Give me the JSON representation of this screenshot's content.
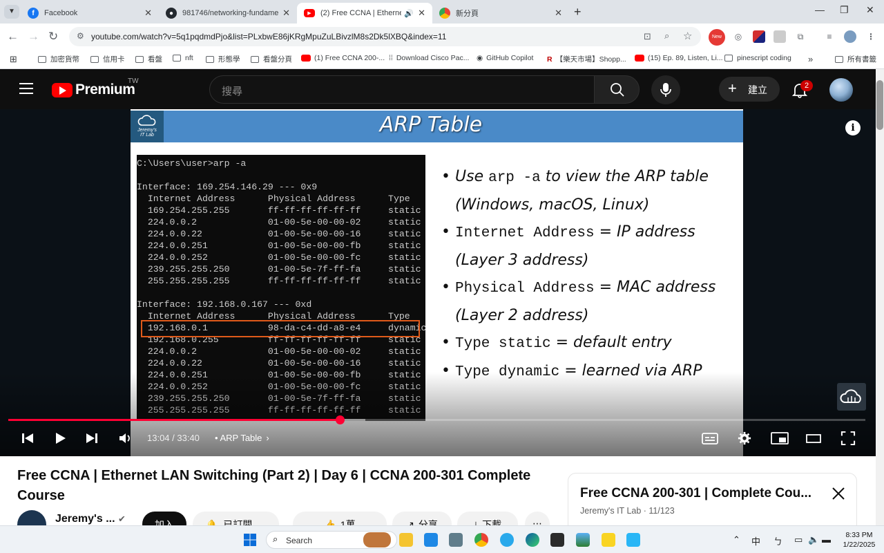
{
  "browser": {
    "tabs": [
      {
        "title": "Facebook",
        "favicon": "facebook-icon",
        "active": false
      },
      {
        "title": "981746/networking-fundament",
        "favicon": "github-icon",
        "active": false
      },
      {
        "title": "(2) Free CCNA | Ethernet LA",
        "favicon": "youtube-icon",
        "active": true
      },
      {
        "title": "新分頁",
        "favicon": "chrome-icon",
        "active": false
      }
    ],
    "new_tab": "+",
    "url": "youtube.com/watch?v=5q1pqdmdPjo&list=PLxbwE86jKRgMpuZuLBivzlM8s2Dk5lXBQ&index=11",
    "ext_new_badge": "New",
    "bookmarks": [
      "加密貨幣",
      "信用卡",
      "看盤",
      "nft",
      "形態學",
      "看盤分頁",
      "(1) Free CCNA 200-...",
      "Download Cisco Pac...",
      "GitHub Copilot",
      "【樂天市場】Shopp...",
      "(15) Ep. 89, Listen, Li...",
      "pinescript coding"
    ],
    "bookmarks_more": "»",
    "all_bookmarks": "所有書籤"
  },
  "youtube": {
    "logo_text": "Premium",
    "region": "TW",
    "search_placeholder": "搜尋",
    "create_label": "建立",
    "notification_count": "2"
  },
  "slide": {
    "logo_text_1": "Jeremy's",
    "logo_text_2": "IT Lab",
    "title": "ARP Table",
    "terminal_lines": [
      "C:\\Users\\user>arp -a",
      "",
      "Interface: 169.254.146.29 --- 0x9",
      "  Internet Address      Physical Address      Type",
      "  169.254.255.255       ff-ff-ff-ff-ff-ff     static",
      "  224.0.0.2             01-00-5e-00-00-02     static",
      "  224.0.0.22            01-00-5e-00-00-16     static",
      "  224.0.0.251           01-00-5e-00-00-fb     static",
      "  224.0.0.252           01-00-5e-00-00-fc     static",
      "  239.255.255.250       01-00-5e-7f-ff-fa     static",
      "  255.255.255.255       ff-ff-ff-ff-ff-ff     static",
      "",
      "Interface: 192.168.0.167 --- 0xd",
      "  Internet Address      Physical Address      Type",
      "  192.168.0.1           98-da-c4-dd-a8-e4     dynamic",
      "  192.168.0.255         ff-ff-ff-ff-ff-ff     static",
      "  224.0.0.2             01-00-5e-00-00-02     static",
      "  224.0.0.22            01-00-5e-00-00-16     static",
      "  224.0.0.251           01-00-5e-00-00-fb     static",
      "  224.0.0.252           01-00-5e-00-00-fc     static",
      "  239.255.255.250       01-00-5e-7f-ff-fa     static",
      "  255.255.255.255       ff-ff-ff-ff-ff-ff     static"
    ],
    "bullets": [
      {
        "pre": "Use ",
        "code": "arp -a",
        "post": " to view the ARP table"
      },
      {
        "pre": "(Windows, macOS, Linux)",
        "code": "",
        "post": "",
        "cont": true
      },
      {
        "pre": "",
        "code": "Internet Address",
        "post": " = IP address"
      },
      {
        "pre": "(Layer 3 address)",
        "code": "",
        "post": "",
        "cont": true
      },
      {
        "pre": "",
        "code": "Physical Address",
        "post": " = MAC address"
      },
      {
        "pre": "(Layer 2 address)",
        "code": "",
        "post": "",
        "cont": true
      },
      {
        "pre": "",
        "code": "Type static",
        "post": " = default entry"
      },
      {
        "pre": "",
        "code": "Type dynamic",
        "post": " = learned via ARP"
      }
    ]
  },
  "player": {
    "time": "13:04 / 33:40",
    "chapter": "• ARP Table",
    "progress_fraction": 0.387,
    "accent_color": "#ff0033"
  },
  "video": {
    "title": "Free CCNA | Ethernet LAN Switching (Part 2) | Day 6 | CCNA 200-301 Complete Course",
    "channel": "Jeremy's ...",
    "join_label": "加入",
    "subscribed_label": "已訂閱",
    "like_count": "1萬",
    "share_label": "分享",
    "download_label": "下載"
  },
  "playlist": {
    "title": "Free CCNA 200-301 | Complete Cou...",
    "meta": "Jeremy's IT Lab · 11/123"
  },
  "taskbar": {
    "search_label": "Search",
    "ime": "中",
    "time": "8:33 PM",
    "date": "1/22/2025"
  }
}
